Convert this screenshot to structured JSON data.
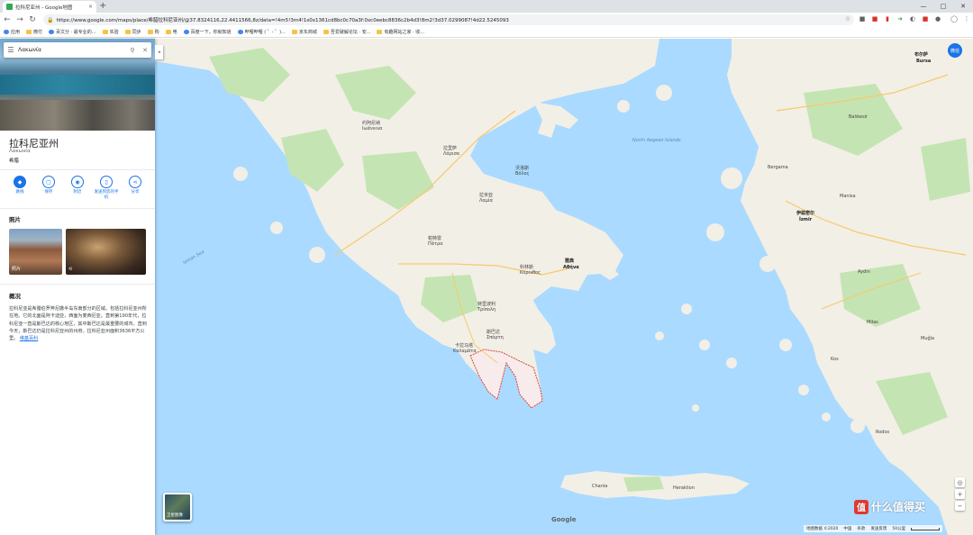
{
  "browser": {
    "tab_title": "拉科尼亚州 - Google地图",
    "tab_close": "×",
    "new_tab": "+",
    "url": "https://www.google.com/maps/place/希腊拉科尼亚州/@37.8324116,22.4411566,8z/data=!4m5!3m4!1s0x1361cd8bc0c70a3f:0xc0eebc8836c2b4d3!8m2!3d37.0299087!4d22.5245093",
    "bookmarks": [
      "应用",
      "微付",
      "百文分 · 最专业的...",
      "实验",
      "同步",
      "购",
      "电",
      "百度一下，你就知道",
      "哔哩哔哩 ( ゜- ゜)...",
      "京东商城",
      "吾爱破解论坛 · 安...",
      "有趣网站之家 · 收..."
    ],
    "window_controls": [
      "—",
      "□",
      "✕"
    ]
  },
  "panel": {
    "search_value": "Λακωνία",
    "place_name": "拉科尼亚州",
    "place_native": "Λακωνία",
    "place_type": "希腊",
    "actions": [
      {
        "icon": "directions-icon",
        "glyph": "◆",
        "label": "路线"
      },
      {
        "icon": "bookmark-icon",
        "glyph": "▢",
        "label": "保存"
      },
      {
        "icon": "nearby-icon",
        "glyph": "◉",
        "label": "附近"
      },
      {
        "icon": "send-to-phone-icon",
        "glyph": "▯",
        "label": "发送到您的手机"
      },
      {
        "icon": "share-icon",
        "glyph": "⋖",
        "label": "分享"
      }
    ],
    "photos_heading": "照片",
    "photo_label": "照片",
    "overview_heading": "概况",
    "overview_text": "拉科尼亚是希腊伯罗奔尼撒半岛东南部分的区域。包括拉科尼亚州所在地。它的北面是阿卡迪亚，西面为麦西尼亚。直到第190年代，拉科尼亚一直是斯巴达的核心地区，其中斯巴达是最重要的城市。直到今天，斯巴达仍是拉科尼亚州的州府。拉科尼亚州面积3636平方公里。",
    "overview_more": "维基百科",
    "collapse_glyph": "◂"
  },
  "map": {
    "user_badge": "微信",
    "satellite_label": "卫星图像",
    "zoom_in": "+",
    "zoom_out": "−",
    "footer": [
      "地图数据 ©2020",
      "中国",
      "条款",
      "发送反馈",
      "50公里"
    ],
    "google_logo": "Google",
    "labels": [
      {
        "t": "North Aegean Islands",
        "c": "sea"
      },
      {
        "t": "Ionian Sea",
        "c": "sea"
      },
      {
        "t": "雅典",
        "c": "city"
      },
      {
        "t": "Αθήνα",
        "c": "city"
      },
      {
        "t": "伊兹密尔",
        "c": "city"
      },
      {
        "t": "İzmir",
        "c": "city"
      },
      {
        "t": "布尔萨",
        "c": "city"
      },
      {
        "t": "Bursa",
        "c": "city"
      },
      {
        "t": "帕特雷",
        "c": ""
      },
      {
        "t": "Πάτρα",
        "c": ""
      },
      {
        "t": "拉里萨",
        "c": ""
      },
      {
        "t": "Λάρισα",
        "c": ""
      },
      {
        "t": "斯巴达",
        "c": ""
      },
      {
        "t": "Σπάρτη",
        "c": ""
      },
      {
        "t": "卡拉马塔",
        "c": ""
      },
      {
        "t": "Καλαμάτα",
        "c": ""
      },
      {
        "t": "特里波利",
        "c": ""
      },
      {
        "t": "Τρίπολη",
        "c": ""
      },
      {
        "t": "科林斯",
        "c": ""
      },
      {
        "t": "Κόρινθος",
        "c": ""
      },
      {
        "t": "沃洛斯",
        "c": ""
      },
      {
        "t": "Βόλος",
        "c": ""
      },
      {
        "t": "拉米亚",
        "c": ""
      },
      {
        "t": "Λαμία",
        "c": ""
      },
      {
        "t": "约阿尼纳",
        "c": ""
      },
      {
        "t": "Ιωάννινα",
        "c": ""
      },
      {
        "t": "Bergama",
        "c": ""
      },
      {
        "t": "Manisa",
        "c": ""
      },
      {
        "t": "Aydın",
        "c": ""
      },
      {
        "t": "Balıkesir",
        "c": ""
      },
      {
        "t": "Kos",
        "c": ""
      },
      {
        "t": "Rodos",
        "c": ""
      },
      {
        "t": "Heraklion",
        "c": ""
      },
      {
        "t": "Chania",
        "c": ""
      },
      {
        "t": "Milas",
        "c": ""
      },
      {
        "t": "Muğla",
        "c": ""
      }
    ]
  },
  "watermark": {
    "icon": "值",
    "text": "什么值得买"
  },
  "colors": {
    "accent": "#1a73e8",
    "land": "#f2efe6",
    "water": "#aadaff",
    "forest": "#c5e4b3",
    "region_outline": "#db4437"
  }
}
